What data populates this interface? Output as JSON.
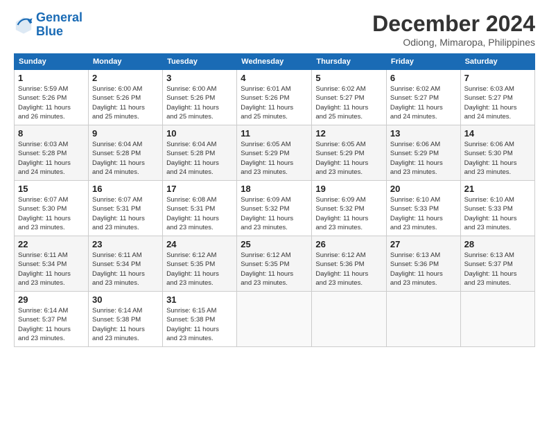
{
  "logo": {
    "line1": "General",
    "line2": "Blue"
  },
  "title": "December 2024",
  "location": "Odiong, Mimaropa, Philippines",
  "days_of_week": [
    "Sunday",
    "Monday",
    "Tuesday",
    "Wednesday",
    "Thursday",
    "Friday",
    "Saturday"
  ],
  "weeks": [
    [
      {
        "day": "1",
        "sunrise": "5:59 AM",
        "sunset": "5:26 PM",
        "daylight": "11 hours and 26 minutes."
      },
      {
        "day": "2",
        "sunrise": "6:00 AM",
        "sunset": "5:26 PM",
        "daylight": "11 hours and 25 minutes."
      },
      {
        "day": "3",
        "sunrise": "6:00 AM",
        "sunset": "5:26 PM",
        "daylight": "11 hours and 25 minutes."
      },
      {
        "day": "4",
        "sunrise": "6:01 AM",
        "sunset": "5:26 PM",
        "daylight": "11 hours and 25 minutes."
      },
      {
        "day": "5",
        "sunrise": "6:02 AM",
        "sunset": "5:27 PM",
        "daylight": "11 hours and 25 minutes."
      },
      {
        "day": "6",
        "sunrise": "6:02 AM",
        "sunset": "5:27 PM",
        "daylight": "11 hours and 24 minutes."
      },
      {
        "day": "7",
        "sunrise": "6:03 AM",
        "sunset": "5:27 PM",
        "daylight": "11 hours and 24 minutes."
      }
    ],
    [
      {
        "day": "8",
        "sunrise": "6:03 AM",
        "sunset": "5:28 PM",
        "daylight": "11 hours and 24 minutes."
      },
      {
        "day": "9",
        "sunrise": "6:04 AM",
        "sunset": "5:28 PM",
        "daylight": "11 hours and 24 minutes."
      },
      {
        "day": "10",
        "sunrise": "6:04 AM",
        "sunset": "5:28 PM",
        "daylight": "11 hours and 24 minutes."
      },
      {
        "day": "11",
        "sunrise": "6:05 AM",
        "sunset": "5:29 PM",
        "daylight": "11 hours and 23 minutes."
      },
      {
        "day": "12",
        "sunrise": "6:05 AM",
        "sunset": "5:29 PM",
        "daylight": "11 hours and 23 minutes."
      },
      {
        "day": "13",
        "sunrise": "6:06 AM",
        "sunset": "5:29 PM",
        "daylight": "11 hours and 23 minutes."
      },
      {
        "day": "14",
        "sunrise": "6:06 AM",
        "sunset": "5:30 PM",
        "daylight": "11 hours and 23 minutes."
      }
    ],
    [
      {
        "day": "15",
        "sunrise": "6:07 AM",
        "sunset": "5:30 PM",
        "daylight": "11 hours and 23 minutes."
      },
      {
        "day": "16",
        "sunrise": "6:07 AM",
        "sunset": "5:31 PM",
        "daylight": "11 hours and 23 minutes."
      },
      {
        "day": "17",
        "sunrise": "6:08 AM",
        "sunset": "5:31 PM",
        "daylight": "11 hours and 23 minutes."
      },
      {
        "day": "18",
        "sunrise": "6:09 AM",
        "sunset": "5:32 PM",
        "daylight": "11 hours and 23 minutes."
      },
      {
        "day": "19",
        "sunrise": "6:09 AM",
        "sunset": "5:32 PM",
        "daylight": "11 hours and 23 minutes."
      },
      {
        "day": "20",
        "sunrise": "6:10 AM",
        "sunset": "5:33 PM",
        "daylight": "11 hours and 23 minutes."
      },
      {
        "day": "21",
        "sunrise": "6:10 AM",
        "sunset": "5:33 PM",
        "daylight": "11 hours and 23 minutes."
      }
    ],
    [
      {
        "day": "22",
        "sunrise": "6:11 AM",
        "sunset": "5:34 PM",
        "daylight": "11 hours and 23 minutes."
      },
      {
        "day": "23",
        "sunrise": "6:11 AM",
        "sunset": "5:34 PM",
        "daylight": "11 hours and 23 minutes."
      },
      {
        "day": "24",
        "sunrise": "6:12 AM",
        "sunset": "5:35 PM",
        "daylight": "11 hours and 23 minutes."
      },
      {
        "day": "25",
        "sunrise": "6:12 AM",
        "sunset": "5:35 PM",
        "daylight": "11 hours and 23 minutes."
      },
      {
        "day": "26",
        "sunrise": "6:12 AM",
        "sunset": "5:36 PM",
        "daylight": "11 hours and 23 minutes."
      },
      {
        "day": "27",
        "sunrise": "6:13 AM",
        "sunset": "5:36 PM",
        "daylight": "11 hours and 23 minutes."
      },
      {
        "day": "28",
        "sunrise": "6:13 AM",
        "sunset": "5:37 PM",
        "daylight": "11 hours and 23 minutes."
      }
    ],
    [
      {
        "day": "29",
        "sunrise": "6:14 AM",
        "sunset": "5:37 PM",
        "daylight": "11 hours and 23 minutes."
      },
      {
        "day": "30",
        "sunrise": "6:14 AM",
        "sunset": "5:38 PM",
        "daylight": "11 hours and 23 minutes."
      },
      {
        "day": "31",
        "sunrise": "6:15 AM",
        "sunset": "5:38 PM",
        "daylight": "11 hours and 23 minutes."
      },
      null,
      null,
      null,
      null
    ]
  ]
}
